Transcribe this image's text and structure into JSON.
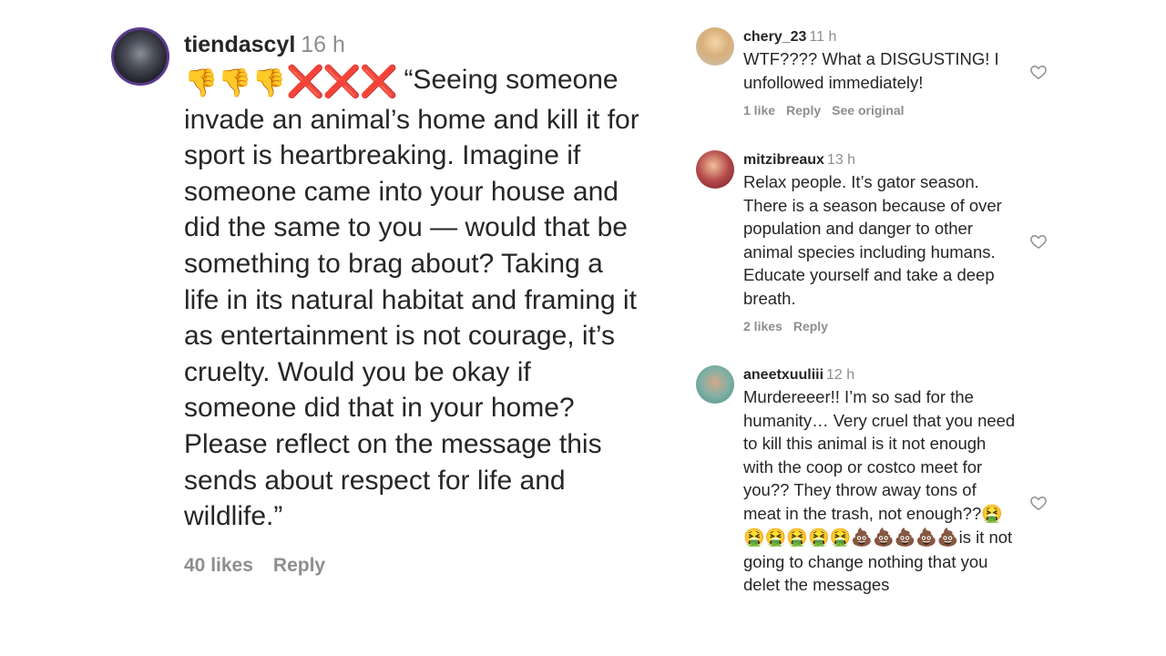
{
  "main_comment": {
    "username": "tiendascyl",
    "time": "16 h",
    "emoji_prefix": [
      "👎",
      "👎",
      "👎"
    ],
    "marks": "❌❌❌",
    "text": "“Seeing someone invade an animal’s home and kill it for sport is heartbreaking. Imagine if someone came into your house and did the same to you — would that be something to brag about? Taking a life in its natural habitat and framing it as entertainment is not courage, it’s cruelty. Would you be okay if someone did that in your home? Please reflect on the message this sends about respect for life and wildlife.”",
    "likes": "40 likes",
    "reply": "Reply"
  },
  "replies": [
    {
      "username": "chery_23",
      "time": "11 h",
      "text": "WTF???? What a DISGUSTING! I unfollowed immediately!",
      "likes": "1 like",
      "reply": "Reply",
      "see_original": "See original"
    },
    {
      "username": "mitzibreaux",
      "time": "13 h",
      "text": "Relax people. It’s gator season. There is a season because of over population and danger to other animal species including humans. Educate yourself and take a deep breath.",
      "likes": "2 likes",
      "reply": "Reply"
    },
    {
      "username": "aneetxuuliii",
      "time": "12 h",
      "text_1": "Murdereeer!! I’m so sad for the humanity… Very cruel that you need to kill this animal is it not enough with the coop or costco meet for you?? They throw away tons of meat in the trash, not enough??",
      "emoji_sick": "🤮🤮🤮🤮🤮🤮",
      "emoji_poop": "💩💩💩💩💩",
      "text_2": "is it not going to change nothing that you delet the messages"
    }
  ],
  "icons": {
    "like": "heart-outline-icon",
    "dislike": "thumbs-down-icon",
    "cross": "cross-mark-icon"
  },
  "colors": {
    "text": "#262626",
    "muted": "#8e8e8e",
    "cross": "#e02020",
    "avatar_ring": "#5a3b8c"
  }
}
